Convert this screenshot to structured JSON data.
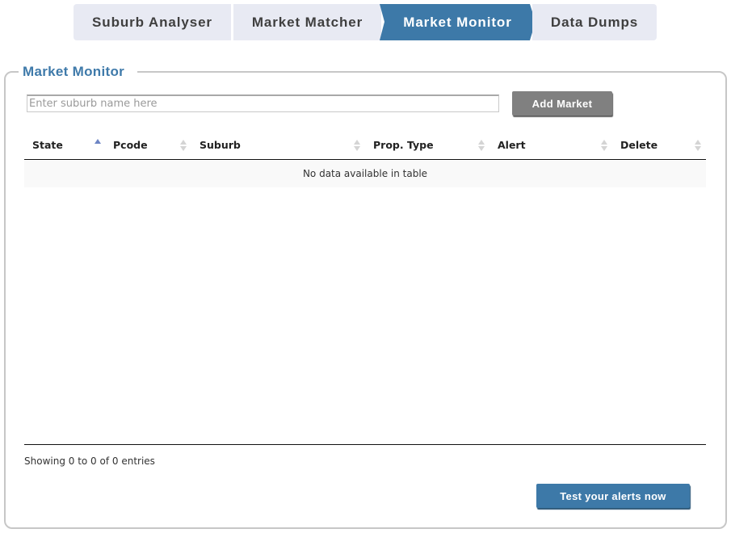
{
  "tabs": [
    {
      "label": "Suburb Analyser",
      "active": false
    },
    {
      "label": "Market Matcher",
      "active": false
    },
    {
      "label": "Market Monitor",
      "active": true
    },
    {
      "label": "Data Dumps",
      "active": false
    }
  ],
  "panel": {
    "title": "Market Monitor"
  },
  "search": {
    "placeholder": "Enter suburb name here",
    "value": ""
  },
  "add_button": "Add Market",
  "table": {
    "columns": [
      "State",
      "Pcode",
      "Suburb",
      "Prop. Type",
      "Alert",
      "Delete"
    ],
    "sorted_column": "State",
    "sort_direction": "ascending",
    "empty_message": "No data available in table",
    "info": "Showing 0 to 0 of 0 entries"
  },
  "test_button": "Test your alerts now",
  "colors": {
    "accent": "#3d79a8",
    "tab_background": "#e8eaf3",
    "button_gray": "#808080",
    "sort_active": "#6d85c4"
  }
}
